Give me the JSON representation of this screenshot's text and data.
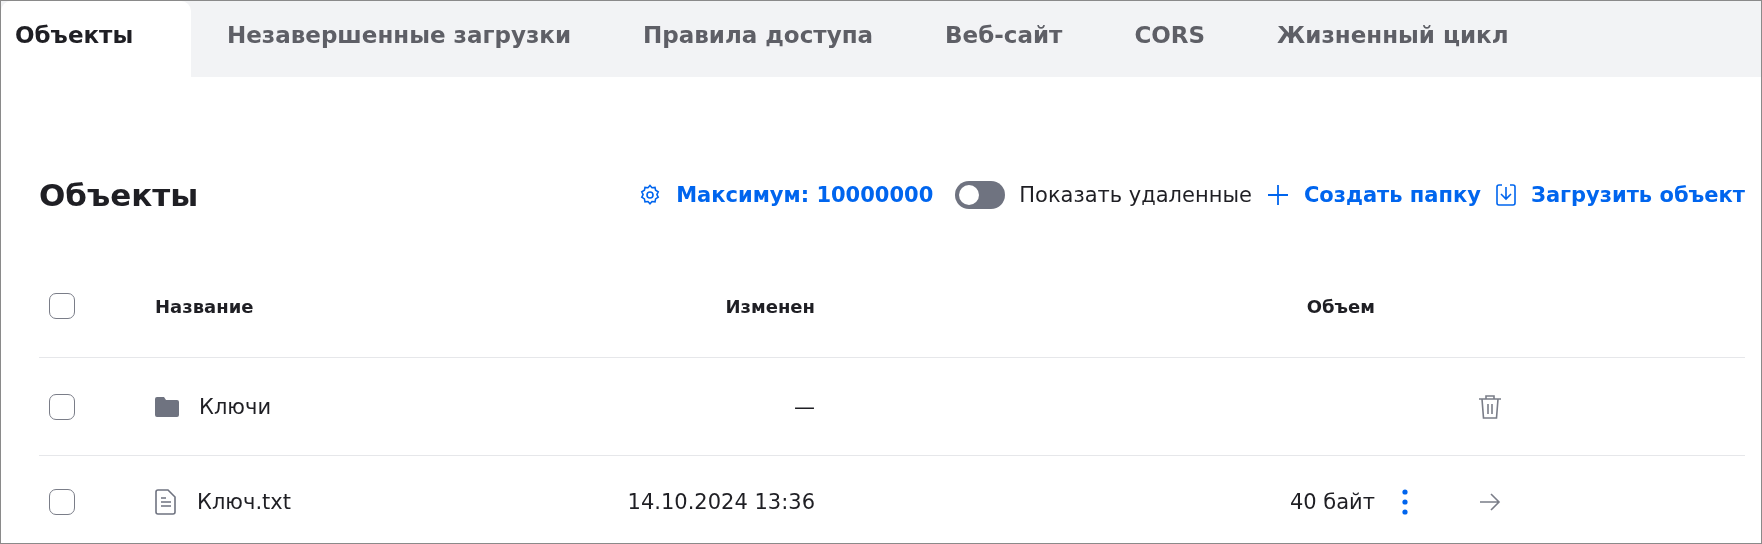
{
  "tabs": [
    {
      "label": "Объекты",
      "selected": true
    },
    {
      "label": "Незавершенные загрузки",
      "selected": false
    },
    {
      "label": "Правила доступа",
      "selected": false
    },
    {
      "label": "Веб-сайт",
      "selected": false
    },
    {
      "label": "CORS",
      "selected": false
    },
    {
      "label": "Жизненный цикл",
      "selected": false
    }
  ],
  "title": "Объекты",
  "toolbar": {
    "limit": "Максимум: 10000000",
    "show_deleted": {
      "label": "Показать удаленные",
      "on": false
    },
    "create_folder": "Создать папку",
    "upload": "Загрузить объект"
  },
  "table": {
    "select_all": {
      "checked": false
    },
    "columns": [
      "Название",
      "Изменен",
      "Объем"
    ],
    "rows": [
      {
        "kind": "folder",
        "name": "Ключи",
        "modified": "—",
        "checked": false
      },
      {
        "kind": "file",
        "name": "Ключ.txt",
        "modified": "14.10.2024 13:36",
        "size": "40 байт",
        "checked": false
      }
    ]
  }
}
